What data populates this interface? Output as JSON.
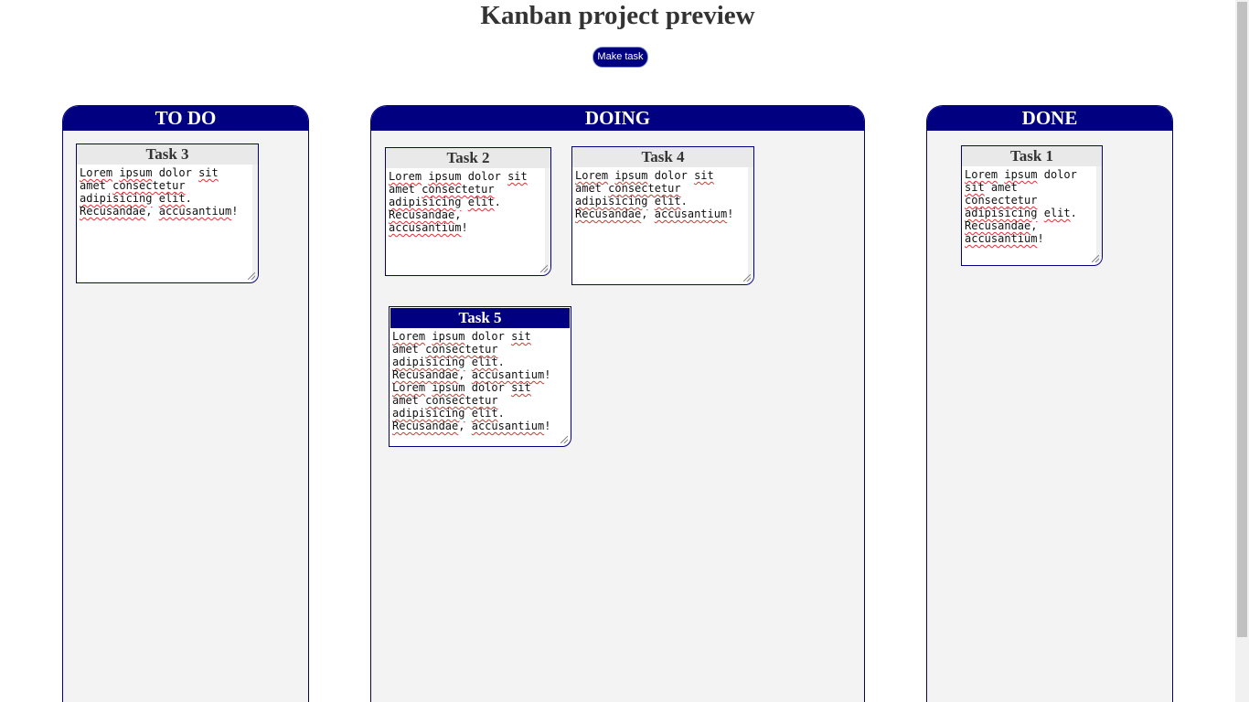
{
  "page": {
    "title": "Kanban project preview",
    "make_task_label": "Make task"
  },
  "colors": {
    "accent": "#000080",
    "column_bg": "#f3f3f3",
    "task_header_bg": "#e9e9e9",
    "title_text": "#333333",
    "spellcheck_underline": "#e03030"
  },
  "columns": [
    {
      "title": "TO DO",
      "tasks": [
        {
          "title": "Task 3",
          "text": "Lorem ipsum dolor sit amet consectetur adipisicing elit. Recusandae, accusantium!"
        }
      ]
    },
    {
      "title": "DOING",
      "tasks": [
        {
          "title": "Task 2",
          "text": "Lorem ipsum dolor sit amet consectetur adipisicing elit. Recusandae, accusantium!"
        },
        {
          "title": "Task 4",
          "text": "Lorem ipsum dolor sit amet consectetur adipisicing elit. Recusandae, accusantium!"
        },
        {
          "title": "Task 5",
          "text": "Lorem ipsum dolor sit amet consectetur adipisicing elit. Recusandae, accusantium!\nLorem ipsum dolor sit amet consectetur adipisicing elit. Recusandae, accusantium!",
          "active": true
        }
      ]
    },
    {
      "title": "DONE",
      "tasks": [
        {
          "title": "Task 1",
          "text": "Lorem ipsum dolor sit amet consectetur adipisicing elit. Recusandae, accusantium!"
        }
      ]
    }
  ]
}
